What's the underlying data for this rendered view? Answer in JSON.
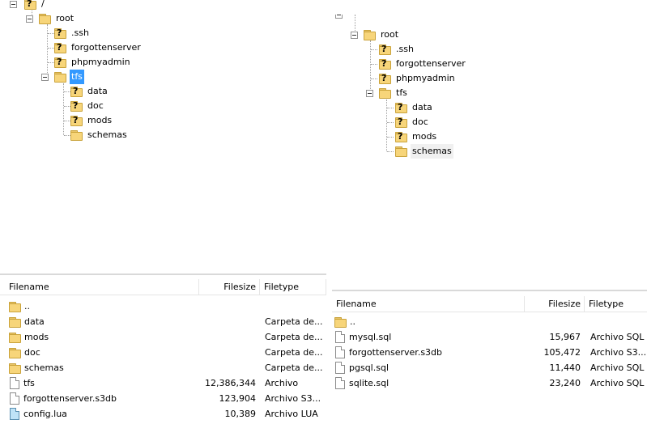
{
  "left_tree": {
    "nodes": [
      {
        "label": "/",
        "icon": "unknown-folder-icon"
      },
      {
        "label": "root",
        "icon": "folder-icon"
      },
      {
        "label": ".ssh",
        "icon": "unknown-folder-icon"
      },
      {
        "label": "forgottenserver",
        "icon": "unknown-folder-icon"
      },
      {
        "label": "phpmyadmin",
        "icon": "unknown-folder-icon"
      },
      {
        "label": "tfs",
        "icon": "folder-icon",
        "selected": true
      },
      {
        "label": "data",
        "icon": "unknown-folder-icon"
      },
      {
        "label": "doc",
        "icon": "unknown-folder-icon"
      },
      {
        "label": "mods",
        "icon": "unknown-folder-icon"
      },
      {
        "label": "schemas",
        "icon": "folder-icon"
      }
    ]
  },
  "right_tree": {
    "nodes": [
      {
        "label": "root",
        "icon": "folder-icon"
      },
      {
        "label": ".ssh",
        "icon": "unknown-folder-icon"
      },
      {
        "label": "forgottenserver",
        "icon": "unknown-folder-icon"
      },
      {
        "label": "phpmyadmin",
        "icon": "unknown-folder-icon"
      },
      {
        "label": "tfs",
        "icon": "folder-icon"
      },
      {
        "label": "data",
        "icon": "unknown-folder-icon"
      },
      {
        "label": "doc",
        "icon": "unknown-folder-icon"
      },
      {
        "label": "mods",
        "icon": "unknown-folder-icon"
      },
      {
        "label": "schemas",
        "icon": "folder-icon",
        "hover": true
      }
    ]
  },
  "left_list": {
    "columns": {
      "filename": "Filename",
      "filesize": "Filesize",
      "filetype": "Filetype"
    },
    "rows": [
      {
        "name": "..",
        "size": "",
        "type": "",
        "icon": "folder-icon"
      },
      {
        "name": "data",
        "size": "",
        "type": "Carpeta de...",
        "icon": "folder-icon"
      },
      {
        "name": "mods",
        "size": "",
        "type": "Carpeta de...",
        "icon": "folder-icon"
      },
      {
        "name": "doc",
        "size": "",
        "type": "Carpeta de...",
        "icon": "folder-icon"
      },
      {
        "name": "schemas",
        "size": "",
        "type": "Carpeta de...",
        "icon": "folder-icon"
      },
      {
        "name": "tfs",
        "size": "12,386,344",
        "type": "Archivo",
        "icon": "file-icon"
      },
      {
        "name": "forgottenserver.s3db",
        "size": "123,904",
        "type": "Archivo S3...",
        "icon": "file-icon"
      },
      {
        "name": "config.lua",
        "size": "10,389",
        "type": "Archivo LUA",
        "icon": "lua-file-icon"
      }
    ]
  },
  "right_list": {
    "columns": {
      "filename": "Filename",
      "filesize": "Filesize",
      "filetype": "Filetype"
    },
    "rows": [
      {
        "name": "..",
        "size": "",
        "type": "",
        "icon": "folder-icon"
      },
      {
        "name": "mysql.sql",
        "size": "15,967",
        "type": "Archivo SQL",
        "icon": "file-icon"
      },
      {
        "name": "forgottenserver.s3db",
        "size": "105,472",
        "type": "Archivo S3...",
        "icon": "file-icon"
      },
      {
        "name": "pgsql.sql",
        "size": "11,440",
        "type": "Archivo SQL",
        "icon": "file-icon"
      },
      {
        "name": "sqlite.sql",
        "size": "23,240",
        "type": "Archivo SQL",
        "icon": "file-icon"
      }
    ]
  },
  "colors": {
    "selection": "#3399ff",
    "folder": "#f7d57a",
    "border": "#e5e5e5"
  }
}
